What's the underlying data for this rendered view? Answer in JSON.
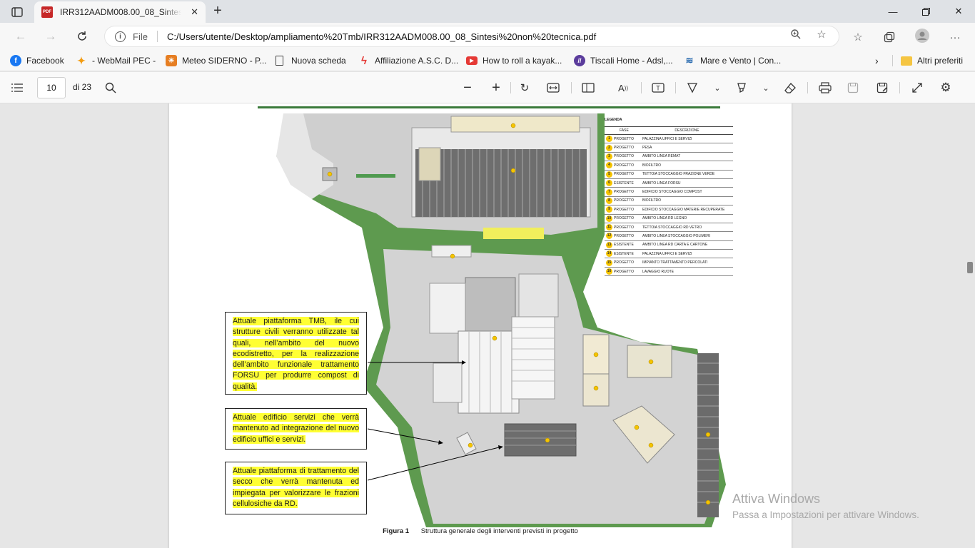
{
  "browser": {
    "tab_title": "IRR312AADM008.00_08_Sintesi non tecnica.pdf",
    "tab_icon_label": "PDF",
    "address": {
      "scheme": "File",
      "url": "C:/Users/utente/Desktop/ampliamento%20Tmb/IRR312AADM008.00_08_Sintesi%20non%20tecnica.pdf"
    },
    "favorites": [
      {
        "label": "Facebook",
        "icon": "facebook-icon",
        "color": "#1877f2"
      },
      {
        "label": "- WebMail PEC -",
        "icon": "webmail-icon",
        "color": "#f39c12"
      },
      {
        "label": "Meteo SIDERNO - P...",
        "icon": "meteo-icon",
        "color": "#e67e22"
      },
      {
        "label": "Nuova scheda",
        "icon": "page-icon",
        "color": "#ffffff"
      },
      {
        "label": "Affiliazione A.S.C. D...",
        "icon": "asc-icon",
        "color": "#e53935"
      },
      {
        "label": "How to roll a kayak...",
        "icon": "youtube-icon",
        "color": "#e53935"
      },
      {
        "label": "Tiscali Home - Adsl,...",
        "icon": "tiscali-icon",
        "color": "#5b3c9c"
      },
      {
        "label": "Mare e Vento | Con...",
        "icon": "wave-icon",
        "color": "#2b6cb0"
      }
    ],
    "other_favorites": "Altri preferiti"
  },
  "pdf_toolbar": {
    "page_current": "10",
    "page_total": "di 23"
  },
  "document": {
    "legend": {
      "title": "LEGENDA",
      "col_phase": "FASE",
      "col_desc": "DESCRIZIONE",
      "rows": [
        {
          "n": "1",
          "phase": "PROGETTO",
          "desc": "PALAZZINA UFFICI E SERVIZI"
        },
        {
          "n": "2",
          "phase": "PROGETTO",
          "desc": "PESA"
        },
        {
          "n": "3",
          "phase": "PROGETTO",
          "desc": "AMBITO LINEA REMAT"
        },
        {
          "n": "4",
          "phase": "PROGETTO",
          "desc": "BIOFILTRO"
        },
        {
          "n": "5",
          "phase": "PROGETTO",
          "desc": "TETTOIA STOCCAGGIO FRAZIONE VERDE"
        },
        {
          "n": "6",
          "phase": "ESISTENTE",
          "desc": "AMBITO LINEA FORSU"
        },
        {
          "n": "7",
          "phase": "PROGETTO",
          "desc": "EDIFICIO STOCCAGGIO COMPOST"
        },
        {
          "n": "8",
          "phase": "PROGETTO",
          "desc": "BIOFILTRO"
        },
        {
          "n": "9",
          "phase": "PROGETTO",
          "desc": "EDIFICIO STOCCAGGIO MATERIE RECUPERATE"
        },
        {
          "n": "10",
          "phase": "PROGETTO",
          "desc": "AMBITO LINEA RD LEGNO"
        },
        {
          "n": "11",
          "phase": "PROGETTO",
          "desc": "TETTOIA STOCCAGGIO RD VETRO"
        },
        {
          "n": "12",
          "phase": "PROGETTO",
          "desc": "AMBITO LINEA STOCCAGGIO POLIMERI"
        },
        {
          "n": "13",
          "phase": "ESISTENTE",
          "desc": "AMBITO LINEA RD CARTA E CARTONE"
        },
        {
          "n": "14",
          "phase": "ESISTENTE",
          "desc": "PALAZZINA UFFICI E SERVIZI"
        },
        {
          "n": "15",
          "phase": "PROGETTO",
          "desc": "IMPIANTO TRATTAMENTO PERCOLATI"
        },
        {
          "n": "16",
          "phase": "PROGETTO",
          "desc": "LAVAGGIO RUOTE"
        }
      ]
    },
    "callouts": [
      "Attuale piattaforma TMB, ile cui strutture civili verranno utilizzate tal quali, nell’ambito del nuovo ecodistretto, per la realizzazione dell’ambito funzionale trattamento FORSU per produrre compost di qualità.",
      "Attuale edificio servizi che verrà mantenuto ad integrazione del nuovo edificio uffici e servizi.",
      "Attuale piattaforma di trattamento del secco che verrà mantenuta ed impiegata per valorizzare le frazioni cellulosiche da RD."
    ],
    "caption_label": "Figura 1",
    "caption_text": "Struttura generale degli interventi previsti in progetto"
  },
  "watermark": {
    "line1": "Attiva Windows",
    "line2": "Passa a Impostazioni per attivare Windows."
  }
}
